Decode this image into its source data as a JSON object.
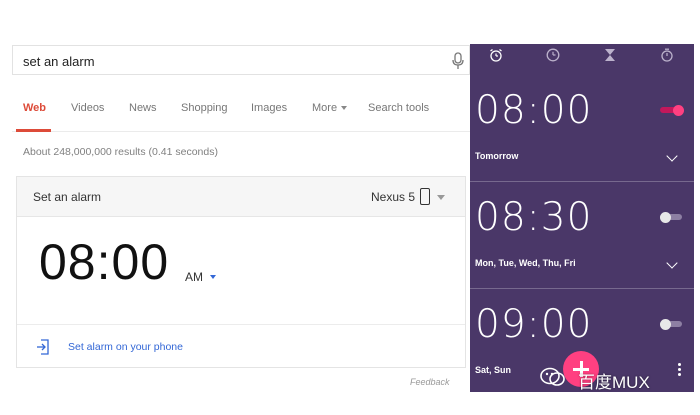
{
  "search": {
    "query": "set an alarm"
  },
  "tabs": [
    {
      "label": "Web",
      "active": true
    },
    {
      "label": "Videos"
    },
    {
      "label": "News"
    },
    {
      "label": "Shopping"
    },
    {
      "label": "Images"
    },
    {
      "label": "More"
    },
    {
      "label": "Search tools"
    }
  ],
  "result_stats": "About 248,000,000 results (0.41 seconds)",
  "card": {
    "title": "Set an alarm",
    "device": "Nexus 5",
    "time": "08:00",
    "ampm": "AM",
    "set_on_phone": "Set alarm on your phone"
  },
  "feedback": "Feedback",
  "clock": {
    "tab_icons": [
      "alarm-clock-icon",
      "clock-icon",
      "hourglass-icon",
      "stopwatch-icon"
    ],
    "alarms": [
      {
        "time": "08:00",
        "days": "Tomorrow",
        "enabled": true
      },
      {
        "time": "08:30",
        "days": "Mon, Tue, Wed, Thu, Fri",
        "enabled": false
      },
      {
        "time": "09:00",
        "days": "Sat, Sun",
        "enabled": false
      }
    ]
  },
  "watermark": {
    "text": "百度MUX"
  },
  "colors": {
    "accent_red": "#dd4b39",
    "link_blue": "#3367d6",
    "clock_bg": "#4a3768",
    "toggle_on": "#ff4081"
  }
}
